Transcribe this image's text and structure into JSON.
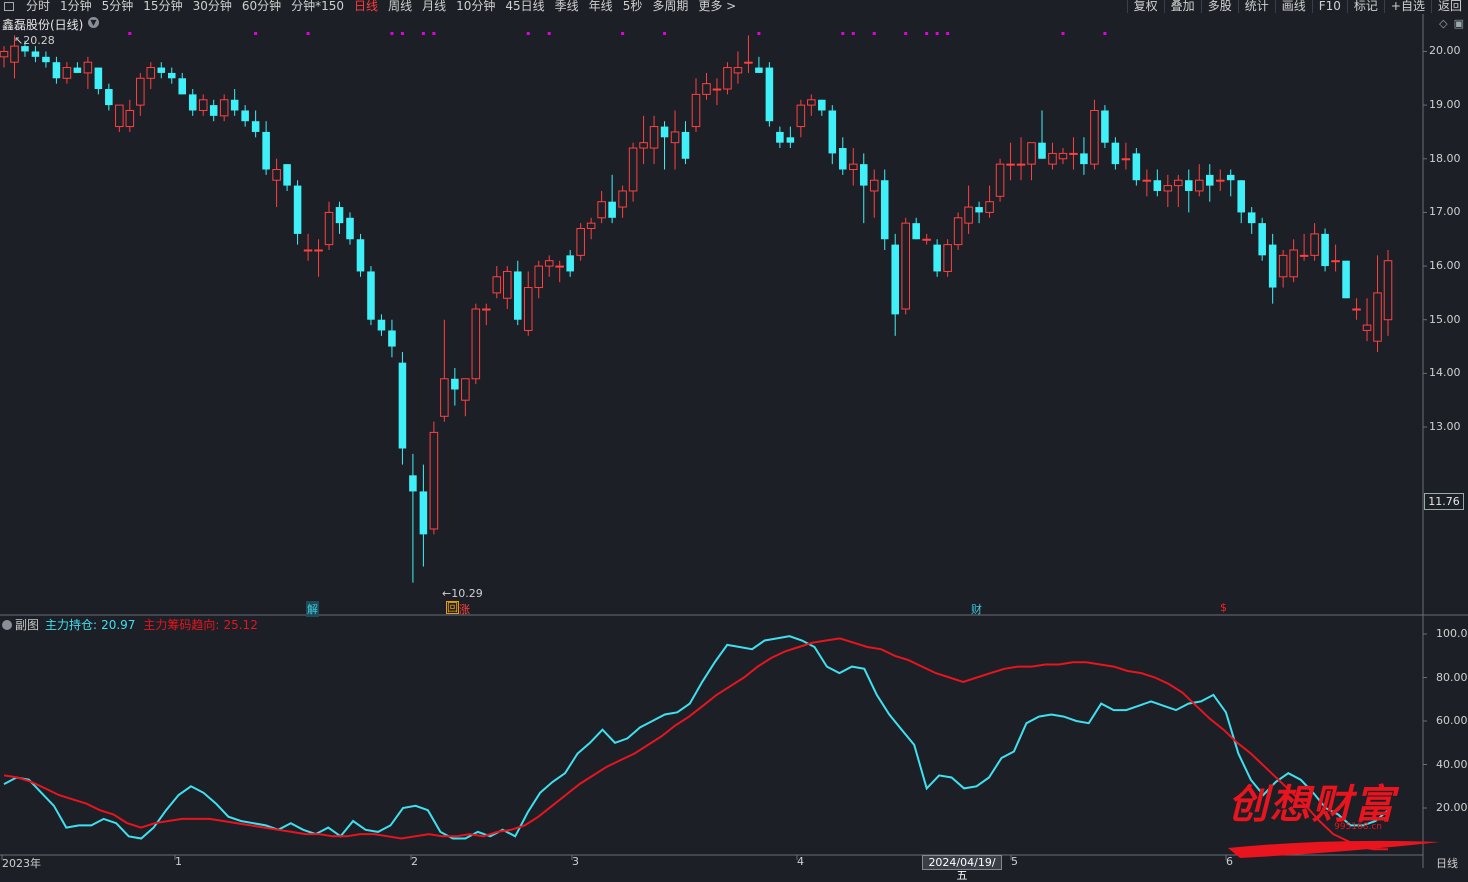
{
  "toolbar": {
    "periods": [
      "分时",
      "1分钟",
      "5分钟",
      "15分钟",
      "30分钟",
      "60分钟",
      "分钟*150",
      "日线",
      "周线",
      "月线",
      "10分钟",
      "45日线",
      "季线",
      "年线",
      "5秒",
      "多周期",
      "更多 >"
    ],
    "active_period": "日线",
    "right_buttons": [
      "复权",
      "叠加",
      "多股",
      "统计",
      "画线",
      "F10",
      "标记",
      "+自选",
      "返回"
    ]
  },
  "stock": {
    "title": "鑫磊股份(日线)"
  },
  "price_axis": {
    "labels": [
      "20.00",
      "19.00",
      "18.00",
      "17.00",
      "16.00",
      "15.00",
      "14.00",
      "13.00"
    ],
    "current": "11.76"
  },
  "annotations": {
    "high": "20.28",
    "low": "10.29"
  },
  "event_markers": [
    {
      "text": "解",
      "color": "#3fc8dc"
    },
    {
      "text": "回",
      "color": "#e8a000"
    },
    {
      "text": "涨",
      "color": "#ff4040"
    },
    {
      "text": "财",
      "color": "#3fc8dc"
    },
    {
      "text": "$",
      "color": "#ff2020"
    }
  ],
  "sub_chart": {
    "label": "副图",
    "indicator1_label": "主力持仓:",
    "indicator1_value": "20.97",
    "indicator2_label": "主力筹码趋向:",
    "indicator2_value": "25.12",
    "axis": [
      "100.00",
      "80.00",
      "60.00",
      "40.00",
      "20.00"
    ]
  },
  "date_axis": [
    "2023年",
    "1",
    "2",
    "3",
    "4",
    "5",
    "6"
  ],
  "crosshair_date": "2024/04/19/五",
  "period_label": "日线",
  "watermark": {
    "text": "创想财富",
    "url": "995168.cn"
  },
  "colors": {
    "up": "#ff4040",
    "down": "#40f0f8",
    "line1": "#3fe0f0",
    "line2": "#e8141e",
    "dot": "#e000e0"
  },
  "chart_data": {
    "type": "candlestick",
    "ylim": [
      10,
      20.4
    ],
    "candles": [
      [
        19.9,
        20.1,
        19.7,
        20.0
      ],
      [
        19.8,
        20.3,
        19.5,
        20.1
      ],
      [
        20.1,
        20.2,
        19.9,
        20.0
      ],
      [
        20.0,
        20.1,
        19.8,
        19.9
      ],
      [
        19.9,
        20.0,
        19.7,
        19.8
      ],
      [
        19.8,
        19.9,
        19.4,
        19.5
      ],
      [
        19.5,
        19.8,
        19.4,
        19.7
      ],
      [
        19.7,
        19.8,
        19.6,
        19.6
      ],
      [
        19.6,
        19.9,
        19.3,
        19.8
      ],
      [
        19.7,
        19.7,
        19.2,
        19.3
      ],
      [
        19.3,
        19.4,
        18.9,
        19.0
      ],
      [
        18.6,
        19.0,
        18.5,
        19.0
      ],
      [
        18.6,
        19.1,
        18.5,
        18.9
      ],
      [
        19.0,
        19.6,
        18.8,
        19.5
      ],
      [
        19.5,
        19.8,
        19.3,
        19.7
      ],
      [
        19.7,
        19.8,
        19.5,
        19.6
      ],
      [
        19.6,
        19.7,
        19.4,
        19.5
      ],
      [
        19.5,
        19.6,
        19.2,
        19.2
      ],
      [
        19.2,
        19.3,
        18.8,
        18.9
      ],
      [
        18.9,
        19.2,
        18.8,
        19.1
      ],
      [
        19.0,
        19.1,
        18.7,
        18.8
      ],
      [
        18.8,
        19.2,
        18.7,
        19.1
      ],
      [
        19.1,
        19.3,
        18.8,
        18.9
      ],
      [
        18.9,
        19.0,
        18.6,
        18.7
      ],
      [
        18.7,
        18.9,
        18.4,
        18.5
      ],
      [
        18.5,
        18.7,
        17.7,
        17.8
      ],
      [
        17.6,
        18.0,
        17.1,
        17.8
      ],
      [
        17.9,
        17.9,
        17.4,
        17.5
      ],
      [
        17.5,
        17.6,
        16.4,
        16.6
      ],
      [
        16.3,
        16.6,
        16.1,
        16.3
      ],
      [
        16.3,
        16.5,
        15.8,
        16.3
      ],
      [
        16.4,
        17.2,
        16.3,
        17.0
      ],
      [
        17.1,
        17.2,
        16.6,
        16.8
      ],
      [
        16.9,
        17.0,
        16.4,
        16.5
      ],
      [
        16.5,
        16.6,
        15.8,
        15.9
      ],
      [
        15.9,
        16.0,
        14.9,
        15.0
      ],
      [
        15.0,
        15.1,
        14.7,
        14.8
      ],
      [
        14.8,
        15.0,
        14.3,
        14.5
      ],
      [
        14.2,
        14.4,
        12.3,
        12.6
      ],
      [
        12.1,
        12.5,
        10.1,
        11.8
      ],
      [
        11.8,
        12.3,
        10.4,
        11.0
      ],
      [
        11.1,
        13.1,
        11.0,
        12.9
      ],
      [
        13.2,
        15.0,
        13.1,
        13.9
      ],
      [
        13.9,
        14.1,
        13.4,
        13.7
      ],
      [
        13.5,
        13.8,
        13.2,
        13.9
      ],
      [
        13.9,
        15.3,
        13.8,
        15.2
      ],
      [
        15.2,
        15.3,
        14.9,
        15.2
      ],
      [
        15.5,
        16.0,
        15.4,
        15.8
      ],
      [
        15.4,
        16.0,
        15.2,
        15.9
      ],
      [
        15.9,
        16.1,
        14.9,
        15.0
      ],
      [
        14.8,
        15.9,
        14.7,
        15.6
      ],
      [
        15.6,
        16.1,
        15.4,
        16.0
      ],
      [
        16.0,
        16.2,
        15.8,
        16.1
      ],
      [
        16.0,
        16.1,
        15.7,
        16.0
      ],
      [
        16.2,
        16.3,
        15.8,
        15.9
      ],
      [
        16.2,
        16.8,
        16.1,
        16.7
      ],
      [
        16.7,
        16.9,
        16.5,
        16.8
      ],
      [
        16.9,
        17.4,
        16.8,
        17.2
      ],
      [
        17.2,
        17.7,
        16.8,
        16.9
      ],
      [
        17.1,
        17.5,
        16.9,
        17.4
      ],
      [
        17.4,
        18.3,
        17.2,
        18.2
      ],
      [
        18.2,
        18.8,
        17.9,
        18.3
      ],
      [
        18.2,
        18.8,
        17.9,
        18.6
      ],
      [
        18.6,
        18.7,
        17.8,
        18.4
      ],
      [
        18.3,
        18.9,
        17.8,
        18.5
      ],
      [
        18.5,
        18.7,
        17.9,
        18.0
      ],
      [
        18.6,
        19.5,
        18.5,
        19.2
      ],
      [
        19.2,
        19.6,
        19.1,
        19.4
      ],
      [
        19.3,
        19.5,
        19.0,
        19.3
      ],
      [
        19.3,
        19.8,
        19.2,
        19.7
      ],
      [
        19.6,
        20.0,
        19.4,
        19.7
      ],
      [
        19.8,
        20.3,
        19.6,
        19.8
      ],
      [
        19.7,
        19.9,
        19.6,
        19.6
      ],
      [
        19.7,
        19.8,
        18.6,
        18.7
      ],
      [
        18.5,
        18.6,
        18.2,
        18.3
      ],
      [
        18.4,
        18.6,
        18.2,
        18.3
      ],
      [
        18.6,
        19.1,
        18.4,
        19.0
      ],
      [
        19.0,
        19.2,
        18.8,
        19.1
      ],
      [
        19.1,
        19.1,
        18.8,
        18.9
      ],
      [
        18.9,
        19.0,
        17.9,
        18.1
      ],
      [
        18.2,
        18.4,
        17.7,
        17.8
      ],
      [
        17.8,
        18.2,
        17.5,
        17.9
      ],
      [
        17.9,
        18.1,
        16.8,
        17.5
      ],
      [
        17.4,
        17.8,
        16.9,
        17.6
      ],
      [
        17.6,
        17.8,
        16.3,
        16.5
      ],
      [
        16.4,
        16.6,
        14.7,
        15.1
      ],
      [
        15.2,
        16.9,
        15.1,
        16.8
      ],
      [
        16.8,
        16.9,
        16.5,
        16.5
      ],
      [
        16.5,
        16.6,
        16.4,
        16.5
      ],
      [
        16.4,
        16.5,
        15.8,
        15.9
      ],
      [
        15.9,
        16.5,
        15.8,
        16.4
      ],
      [
        16.4,
        17.0,
        16.3,
        16.9
      ],
      [
        16.8,
        17.5,
        16.6,
        17.1
      ],
      [
        17.1,
        17.2,
        16.8,
        17.0
      ],
      [
        17.0,
        17.5,
        16.9,
        17.2
      ],
      [
        17.3,
        18.0,
        17.2,
        17.9
      ],
      [
        17.9,
        18.3,
        17.6,
        17.9
      ],
      [
        17.9,
        18.4,
        17.6,
        17.9
      ],
      [
        17.9,
        18.3,
        17.6,
        18.3
      ],
      [
        18.3,
        18.9,
        18.0,
        18.0
      ],
      [
        17.9,
        18.3,
        17.8,
        18.1
      ],
      [
        18.0,
        18.2,
        17.9,
        18.1
      ],
      [
        18.1,
        18.4,
        17.8,
        18.1
      ],
      [
        18.1,
        18.4,
        17.7,
        17.9
      ],
      [
        17.9,
        19.1,
        17.8,
        18.9
      ],
      [
        18.9,
        19.0,
        18.2,
        18.3
      ],
      [
        18.3,
        18.4,
        17.8,
        17.9
      ],
      [
        18.0,
        18.3,
        17.8,
        18.0
      ],
      [
        18.1,
        18.2,
        17.5,
        17.6
      ],
      [
        17.6,
        17.8,
        17.3,
        17.6
      ],
      [
        17.6,
        17.8,
        17.3,
        17.4
      ],
      [
        17.4,
        17.7,
        17.1,
        17.5
      ],
      [
        17.5,
        17.7,
        17.1,
        17.6
      ],
      [
        17.6,
        17.8,
        17.0,
        17.4
      ],
      [
        17.4,
        17.9,
        17.3,
        17.6
      ],
      [
        17.7,
        17.9,
        17.2,
        17.5
      ],
      [
        17.6,
        17.8,
        17.4,
        17.6
      ],
      [
        17.7,
        17.8,
        17.3,
        17.6
      ],
      [
        17.6,
        17.6,
        16.8,
        17.0
      ],
      [
        17.0,
        17.1,
        16.6,
        16.8
      ],
      [
        16.8,
        16.9,
        16.1,
        16.2
      ],
      [
        16.4,
        16.6,
        15.3,
        15.6
      ],
      [
        15.8,
        16.3,
        15.6,
        16.2
      ],
      [
        15.8,
        16.5,
        15.7,
        16.3
      ],
      [
        16.2,
        16.6,
        16.1,
        16.2
      ],
      [
        16.2,
        16.8,
        16.1,
        16.6
      ],
      [
        16.6,
        16.7,
        15.9,
        16.0
      ],
      [
        16.1,
        16.4,
        15.9,
        16.1
      ],
      [
        16.1,
        16.1,
        15.4,
        15.4
      ],
      [
        15.2,
        15.4,
        15.0,
        15.2
      ],
      [
        14.8,
        15.4,
        14.6,
        14.9
      ],
      [
        14.6,
        16.2,
        14.4,
        15.5
      ],
      [
        15.0,
        16.3,
        14.7,
        16.1
      ]
    ],
    "dot_columns": [
      12,
      24,
      29,
      37,
      38,
      40,
      41,
      50,
      52,
      59,
      63,
      72,
      80,
      81,
      83,
      86,
      88,
      89,
      90,
      101,
      105
    ],
    "series": [
      {
        "name": "主力持仓",
        "values": [
          31,
          34,
          33,
          27,
          21,
          11,
          12,
          12,
          15,
          13,
          7,
          6,
          11,
          19,
          26,
          30,
          27,
          22,
          16,
          14,
          13,
          12,
          10,
          13,
          10,
          8,
          11,
          7,
          14,
          10,
          9,
          12,
          20,
          21,
          19,
          9,
          6,
          6,
          9,
          7,
          10,
          7,
          18,
          27,
          32,
          36,
          45,
          50,
          56,
          50,
          52,
          57,
          60,
          63,
          64,
          68,
          78,
          87,
          95,
          94,
          93,
          97,
          98,
          99,
          97,
          94,
          85,
          82,
          85,
          84,
          72,
          63,
          56,
          49,
          29,
          35,
          34,
          29,
          30,
          34,
          43,
          46,
          59,
          62,
          63,
          62,
          60,
          59,
          68,
          65,
          65,
          67,
          69,
          67,
          65,
          68,
          69,
          72,
          64,
          45,
          33,
          26,
          32,
          36,
          33,
          27,
          20,
          17,
          12,
          12,
          14,
          19
        ]
      },
      {
        "name": "主力筹码趋向",
        "values": [
          35,
          34,
          32,
          29,
          26,
          24,
          22,
          19,
          17,
          13,
          11,
          13,
          14,
          15,
          15,
          15,
          14,
          13,
          12,
          11,
          10,
          9,
          8,
          8,
          7,
          7,
          8,
          8,
          7,
          6,
          7,
          8,
          7,
          7,
          8,
          7,
          9,
          10,
          12,
          16,
          21,
          26,
          31,
          35,
          39,
          42,
          45,
          49,
          53,
          58,
          62,
          67,
          72,
          76,
          80,
          85,
          89,
          92,
          94,
          96,
          97,
          98,
          96,
          94,
          93,
          90,
          88,
          85,
          82,
          80,
          78,
          80,
          82,
          84,
          85,
          85,
          86,
          86,
          87,
          87,
          86,
          85,
          83,
          82,
          80,
          77,
          73,
          67,
          61,
          56,
          50,
          45,
          39,
          33,
          27,
          21,
          14,
          8,
          5,
          2,
          1,
          1
        ]
      }
    ]
  }
}
